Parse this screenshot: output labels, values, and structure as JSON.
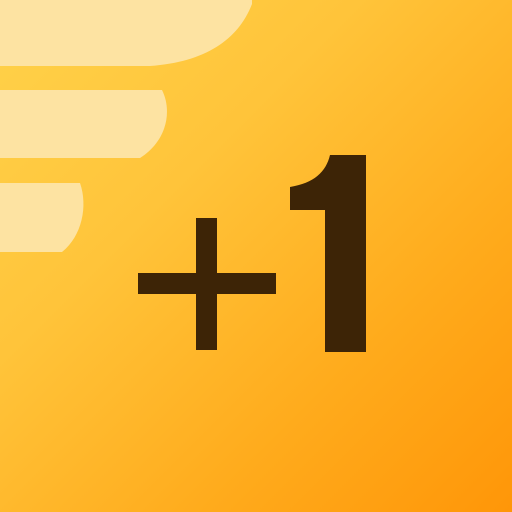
{
  "badge": {
    "text": "+1"
  },
  "colors": {
    "gradient_start": "#ffd24a",
    "gradient_end": "#ff9608",
    "wing": "#fde3a2",
    "glyph": "#3d2406"
  },
  "icons": {
    "wing": "wing-icon",
    "plus": "plus-icon",
    "one": "digit-one-icon"
  }
}
